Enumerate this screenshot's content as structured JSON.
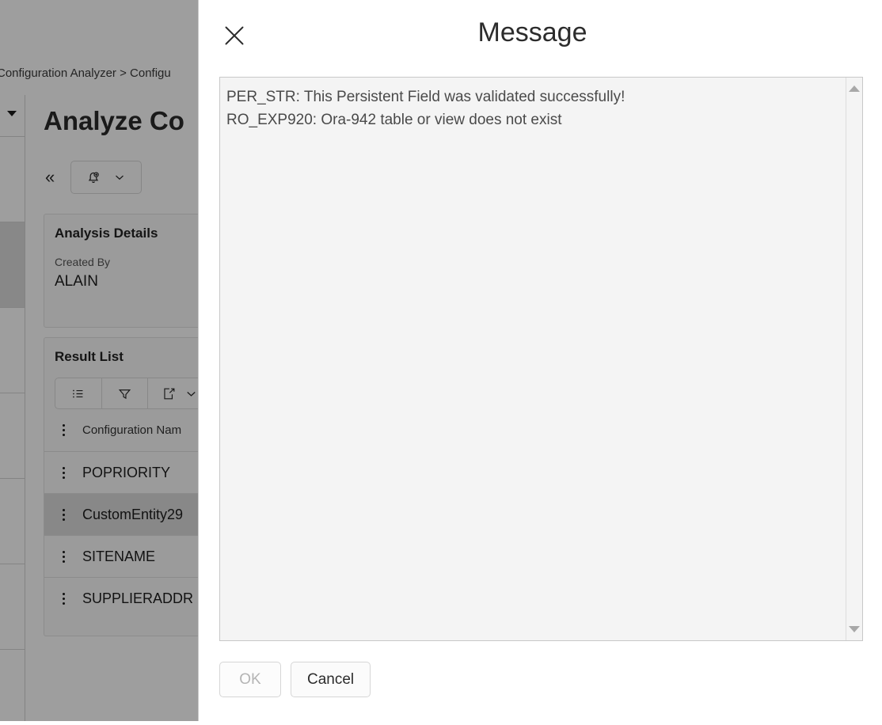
{
  "background": {
    "breadcrumb": "Configuration Analyzer > Configu",
    "page_title": "Analyze Co",
    "toolbar": {
      "collapse_label": "«",
      "bell_icon": "bell-add-icon",
      "chevron_icon": "chevron-down-icon"
    },
    "analysis_details": {
      "title": "Analysis Details",
      "created_by_label": "Created By",
      "created_by_value": "ALAIN"
    },
    "result_list": {
      "title": "Result List",
      "toolbar_icons": [
        "list-icon",
        "filter-icon",
        "export-icon",
        "chevron-down-icon"
      ],
      "column_header": "Configuration Nam",
      "rows": [
        {
          "label": "POPRIORITY",
          "selected": false
        },
        {
          "label": "CustomEntity29",
          "selected": true
        },
        {
          "label": "SITENAME",
          "selected": false
        },
        {
          "label": "SUPPLIERADDR",
          "selected": false
        }
      ]
    }
  },
  "dialog": {
    "title": "Message",
    "close_icon": "close-icon",
    "message_text": "PER_STR: This Persistent Field was validated successfully!\nRO_EXP920: Ora-942 table or view does not exist",
    "scrollbar": {
      "up_icon": "scroll-up-arrow-icon",
      "down_icon": "scroll-down-arrow-icon"
    },
    "buttons": {
      "ok_label": "OK",
      "ok_disabled": true,
      "cancel_label": "Cancel"
    }
  },
  "colors": {
    "dialog_background": "#ffffff",
    "textarea_background": "#f4f4f4",
    "overlay_dim": "rgba(0,0,0,0.38)",
    "text_primary": "#2c2c2c",
    "text_message": "#4a4a4a",
    "disabled_text": "#b4b4b4"
  }
}
